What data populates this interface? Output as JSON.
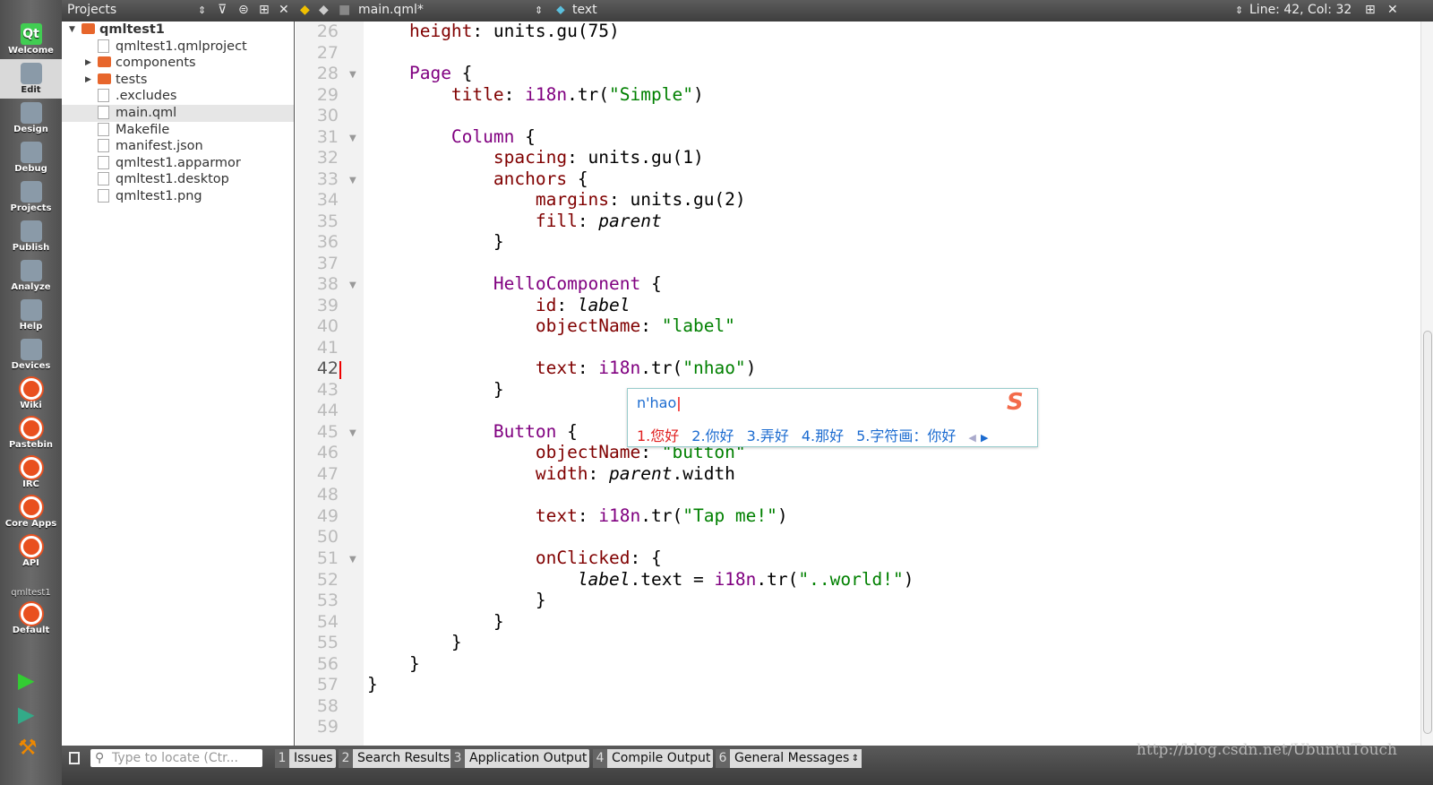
{
  "modes": [
    "Welcome",
    "Edit",
    "Design",
    "Debug",
    "Projects",
    "Publish",
    "Analyze",
    "Help",
    "Devices",
    "Wiki",
    "Pastebin",
    "IRC",
    "Core Apps",
    "API"
  ],
  "target": {
    "project": "qmltest1",
    "config": "Default"
  },
  "projects_panel": {
    "title": "Projects",
    "tree": [
      {
        "label": "qmltest1",
        "level": 0,
        "type": "project",
        "expanded": true
      },
      {
        "label": "qmltest1.qmlproject",
        "level": 1,
        "type": "file"
      },
      {
        "label": "components",
        "level": 1,
        "type": "folder"
      },
      {
        "label": "tests",
        "level": 1,
        "type": "folder"
      },
      {
        "label": ".excludes",
        "level": 1,
        "type": "file"
      },
      {
        "label": "main.qml",
        "level": 1,
        "type": "file",
        "selected": true
      },
      {
        "label": "Makefile",
        "level": 1,
        "type": "file"
      },
      {
        "label": "manifest.json",
        "level": 1,
        "type": "file"
      },
      {
        "label": "qmltest1.apparmor",
        "level": 1,
        "type": "file"
      },
      {
        "label": "qmltest1.desktop",
        "level": 1,
        "type": "file"
      },
      {
        "label": "qmltest1.png",
        "level": 1,
        "type": "file"
      }
    ]
  },
  "editor": {
    "file": "main.qml*",
    "symbol": "text",
    "position": "Line: 42, Col: 32",
    "current_line": 42,
    "first_line": 26,
    "folds": [
      28,
      31,
      33,
      38,
      45,
      51
    ],
    "lines": [
      [
        [
          "n",
          "    "
        ],
        [
          "p",
          "height"
        ],
        [
          "n",
          ": units.gu(75)"
        ]
      ],
      [],
      [
        [
          "n",
          "    "
        ],
        [
          "k",
          "Page"
        ],
        [
          "n",
          " {"
        ]
      ],
      [
        [
          "n",
          "        "
        ],
        [
          "p",
          "title"
        ],
        [
          "n",
          ": "
        ],
        [
          "f",
          "i18n"
        ],
        [
          "n",
          ".tr("
        ],
        [
          "s",
          "\"Simple\""
        ],
        [
          "n",
          ")"
        ]
      ],
      [],
      [
        [
          "n",
          "        "
        ],
        [
          "k",
          "Column"
        ],
        [
          "n",
          " {"
        ]
      ],
      [
        [
          "n",
          "            "
        ],
        [
          "p",
          "spacing"
        ],
        [
          "n",
          ": units.gu(1)"
        ]
      ],
      [
        [
          "n",
          "            "
        ],
        [
          "p",
          "anchors"
        ],
        [
          "n",
          " {"
        ]
      ],
      [
        [
          "n",
          "                "
        ],
        [
          "p",
          "margins"
        ],
        [
          "n",
          ": units.gu(2)"
        ]
      ],
      [
        [
          "n",
          "                "
        ],
        [
          "p",
          "fill"
        ],
        [
          "n",
          ": "
        ],
        [
          "i",
          "parent"
        ]
      ],
      [
        [
          "n",
          "            }"
        ]
      ],
      [],
      [
        [
          "n",
          "            "
        ],
        [
          "k",
          "HelloComponent"
        ],
        [
          "n",
          " {"
        ]
      ],
      [
        [
          "n",
          "                "
        ],
        [
          "p",
          "id"
        ],
        [
          "n",
          ": "
        ],
        [
          "i",
          "label"
        ]
      ],
      [
        [
          "n",
          "                "
        ],
        [
          "p",
          "objectName"
        ],
        [
          "n",
          ": "
        ],
        [
          "s",
          "\"label\""
        ]
      ],
      [],
      [
        [
          "n",
          "                "
        ],
        [
          "p",
          "text"
        ],
        [
          "n",
          ": "
        ],
        [
          "f",
          "i18n"
        ],
        [
          "n",
          ".tr("
        ],
        [
          "s",
          "\"nhao\""
        ],
        [
          "n",
          ")"
        ]
      ],
      [
        [
          "n",
          "            }"
        ]
      ],
      [],
      [
        [
          "n",
          "            "
        ],
        [
          "k",
          "Button"
        ],
        [
          "n",
          " {"
        ]
      ],
      [
        [
          "n",
          "                "
        ],
        [
          "p",
          "objectName"
        ],
        [
          "n",
          ": "
        ],
        [
          "s",
          "\"button\""
        ]
      ],
      [
        [
          "n",
          "                "
        ],
        [
          "p",
          "width"
        ],
        [
          "n",
          ": "
        ],
        [
          "i",
          "parent"
        ],
        [
          "n",
          ".width"
        ]
      ],
      [],
      [
        [
          "n",
          "                "
        ],
        [
          "p",
          "text"
        ],
        [
          "n",
          ": "
        ],
        [
          "f",
          "i18n"
        ],
        [
          "n",
          ".tr("
        ],
        [
          "s",
          "\"Tap me!\""
        ],
        [
          "n",
          ")"
        ]
      ],
      [],
      [
        [
          "n",
          "                "
        ],
        [
          "p",
          "onClicked"
        ],
        [
          "n",
          ": {"
        ]
      ],
      [
        [
          "n",
          "                    "
        ],
        [
          "i",
          "label"
        ],
        [
          "n",
          ".text = "
        ],
        [
          "f",
          "i18n"
        ],
        [
          "n",
          ".tr("
        ],
        [
          "s",
          "\"..world!\""
        ],
        [
          "n",
          ")"
        ]
      ],
      [
        [
          "n",
          "                }"
        ]
      ],
      [
        [
          "n",
          "            }"
        ]
      ],
      [
        [
          "n",
          "        }"
        ]
      ],
      [
        [
          "n",
          "    }"
        ]
      ],
      [
        [
          "n",
          "}"
        ]
      ],
      [],
      []
    ]
  },
  "ime": {
    "composition": "n'hao",
    "candidates": [
      "1.您好",
      "2.你好",
      "3.弄好",
      "4.那好",
      "5.字符画：你好"
    ]
  },
  "bottom": {
    "locate_placeholder": "Type to locate (Ctr...",
    "tabs": [
      {
        "n": "1",
        "label": "Issues"
      },
      {
        "n": "2",
        "label": "Search Results"
      },
      {
        "n": "3",
        "label": "Application Output"
      },
      {
        "n": "4",
        "label": "Compile Output"
      },
      {
        "n": "6",
        "label": "General Messages"
      }
    ]
  },
  "watermark": "http://blog.csdn.net/UbuntuTouch"
}
